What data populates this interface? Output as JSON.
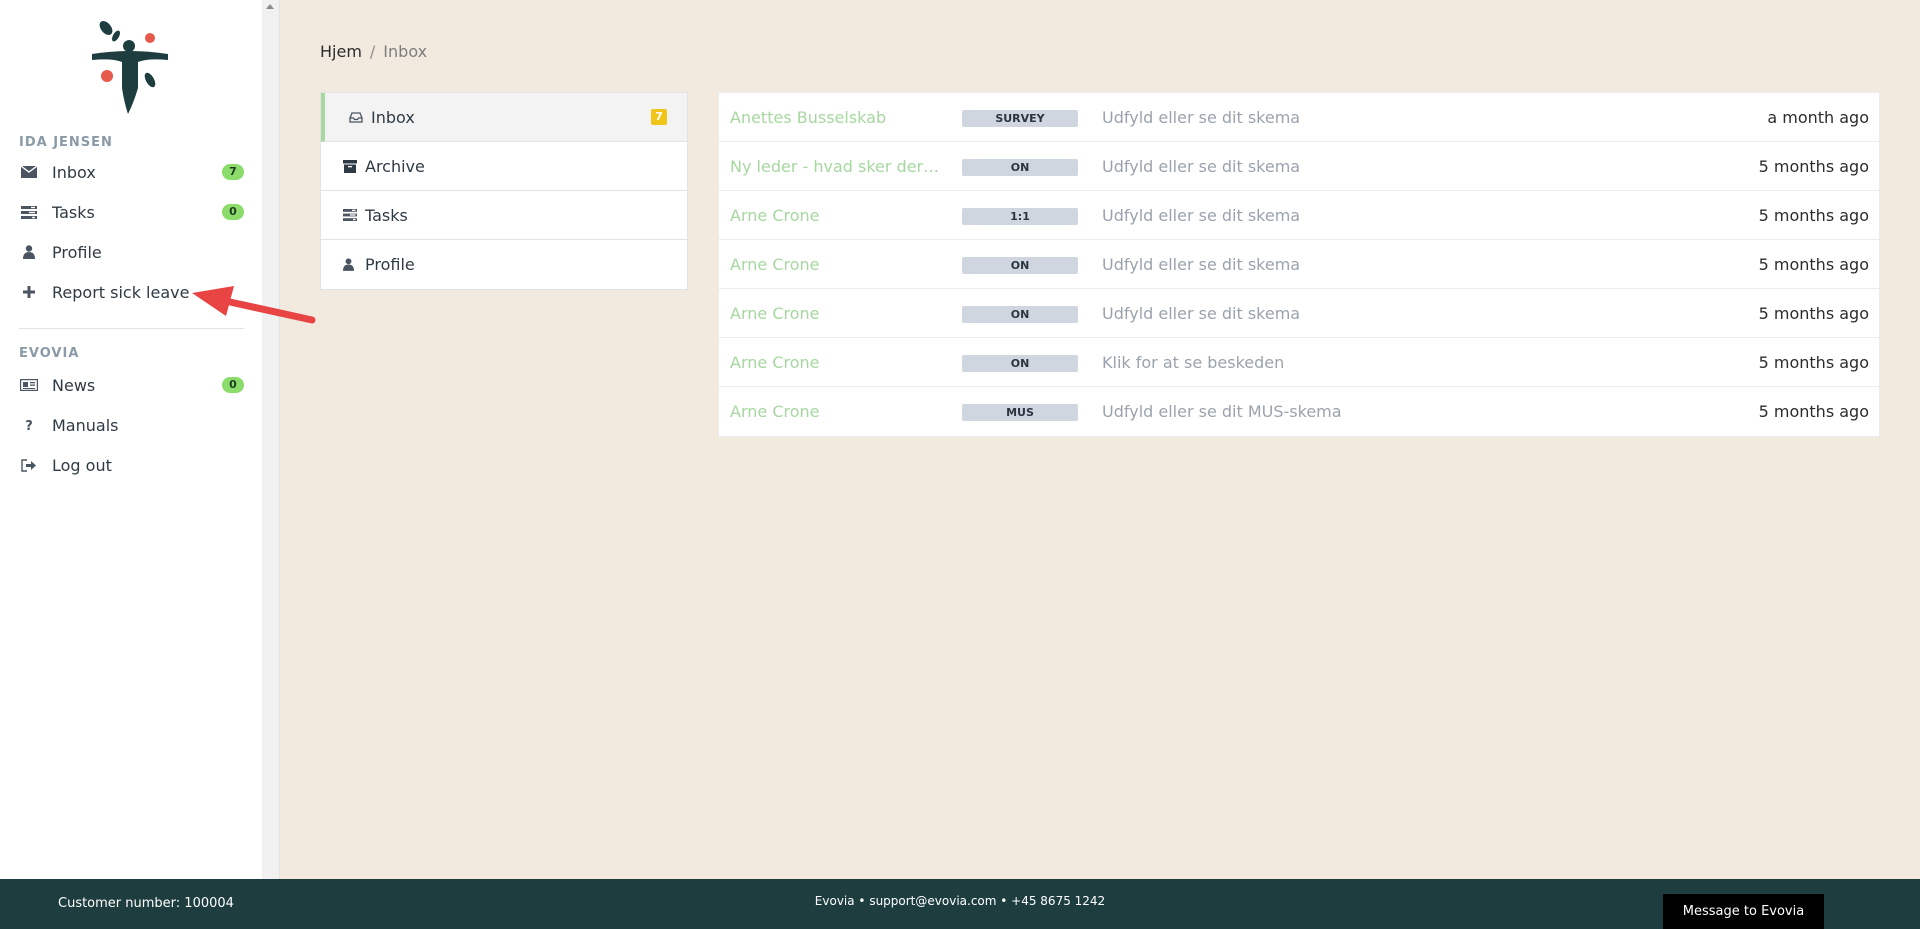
{
  "sidebar": {
    "user_section": "IDA JENSEN",
    "user_items": [
      {
        "label": "Inbox",
        "count": "7",
        "icon": "envelope-icon"
      },
      {
        "label": "Tasks",
        "count": "0",
        "icon": "tasks-icon"
      },
      {
        "label": "Profile",
        "icon": "user-icon"
      },
      {
        "label": "Report sick leave",
        "icon": "plus-icon"
      }
    ],
    "org_section": "EVOVIA",
    "org_items": [
      {
        "label": "News",
        "count": "0",
        "icon": "newspaper-icon"
      },
      {
        "label": "Manuals",
        "icon": "question-icon"
      },
      {
        "label": "Log out",
        "icon": "logout-icon"
      }
    ]
  },
  "breadcrumb": {
    "home": "Hjem",
    "separator": "/",
    "current": "Inbox"
  },
  "folders": [
    {
      "label": "Inbox",
      "badge": "7",
      "icon": "inbox-icon",
      "active": true
    },
    {
      "label": "Archive",
      "icon": "archive-icon"
    },
    {
      "label": "Tasks",
      "icon": "tasks-icon"
    },
    {
      "label": "Profile",
      "icon": "user-icon"
    }
  ],
  "messages": [
    {
      "sender": "Anettes Busselskab",
      "tag": "SURVEY",
      "subject": "Udfyld eller se dit skema",
      "time": "a month ago"
    },
    {
      "sender": "Ny leder - hvad sker der ...",
      "tag": "ON",
      "subject": "Udfyld eller se dit skema",
      "time": "5 months ago"
    },
    {
      "sender": "Arne Crone",
      "tag": "1:1",
      "subject": "Udfyld eller se dit skema",
      "time": "5 months ago"
    },
    {
      "sender": "Arne Crone",
      "tag": "ON",
      "subject": "Udfyld eller se dit skema",
      "time": "5 months ago"
    },
    {
      "sender": "Arne Crone",
      "tag": "ON",
      "subject": "Udfyld eller se dit skema",
      "time": "5 months ago"
    },
    {
      "sender": "Arne Crone",
      "tag": "ON",
      "subject": "Klik for at se beskeden",
      "time": "5 months ago"
    },
    {
      "sender": "Arne Crone",
      "tag": "MUS",
      "subject": "Udfyld eller se dit MUS-skema",
      "time": "5 months ago"
    }
  ],
  "footer": {
    "customer": "Customer number: 100004",
    "contact": "Evovia • support@evovia.com • +45 8675 1242",
    "message_button": "Message to Evovia"
  },
  "colors": {
    "background": "#f3eadf",
    "sender": "#a7d7a0",
    "count_badge": "#8bdc6a",
    "folder_badge": "#f0c419",
    "footer": "#1e3d3f",
    "annotation_arrow": "#e84444"
  }
}
